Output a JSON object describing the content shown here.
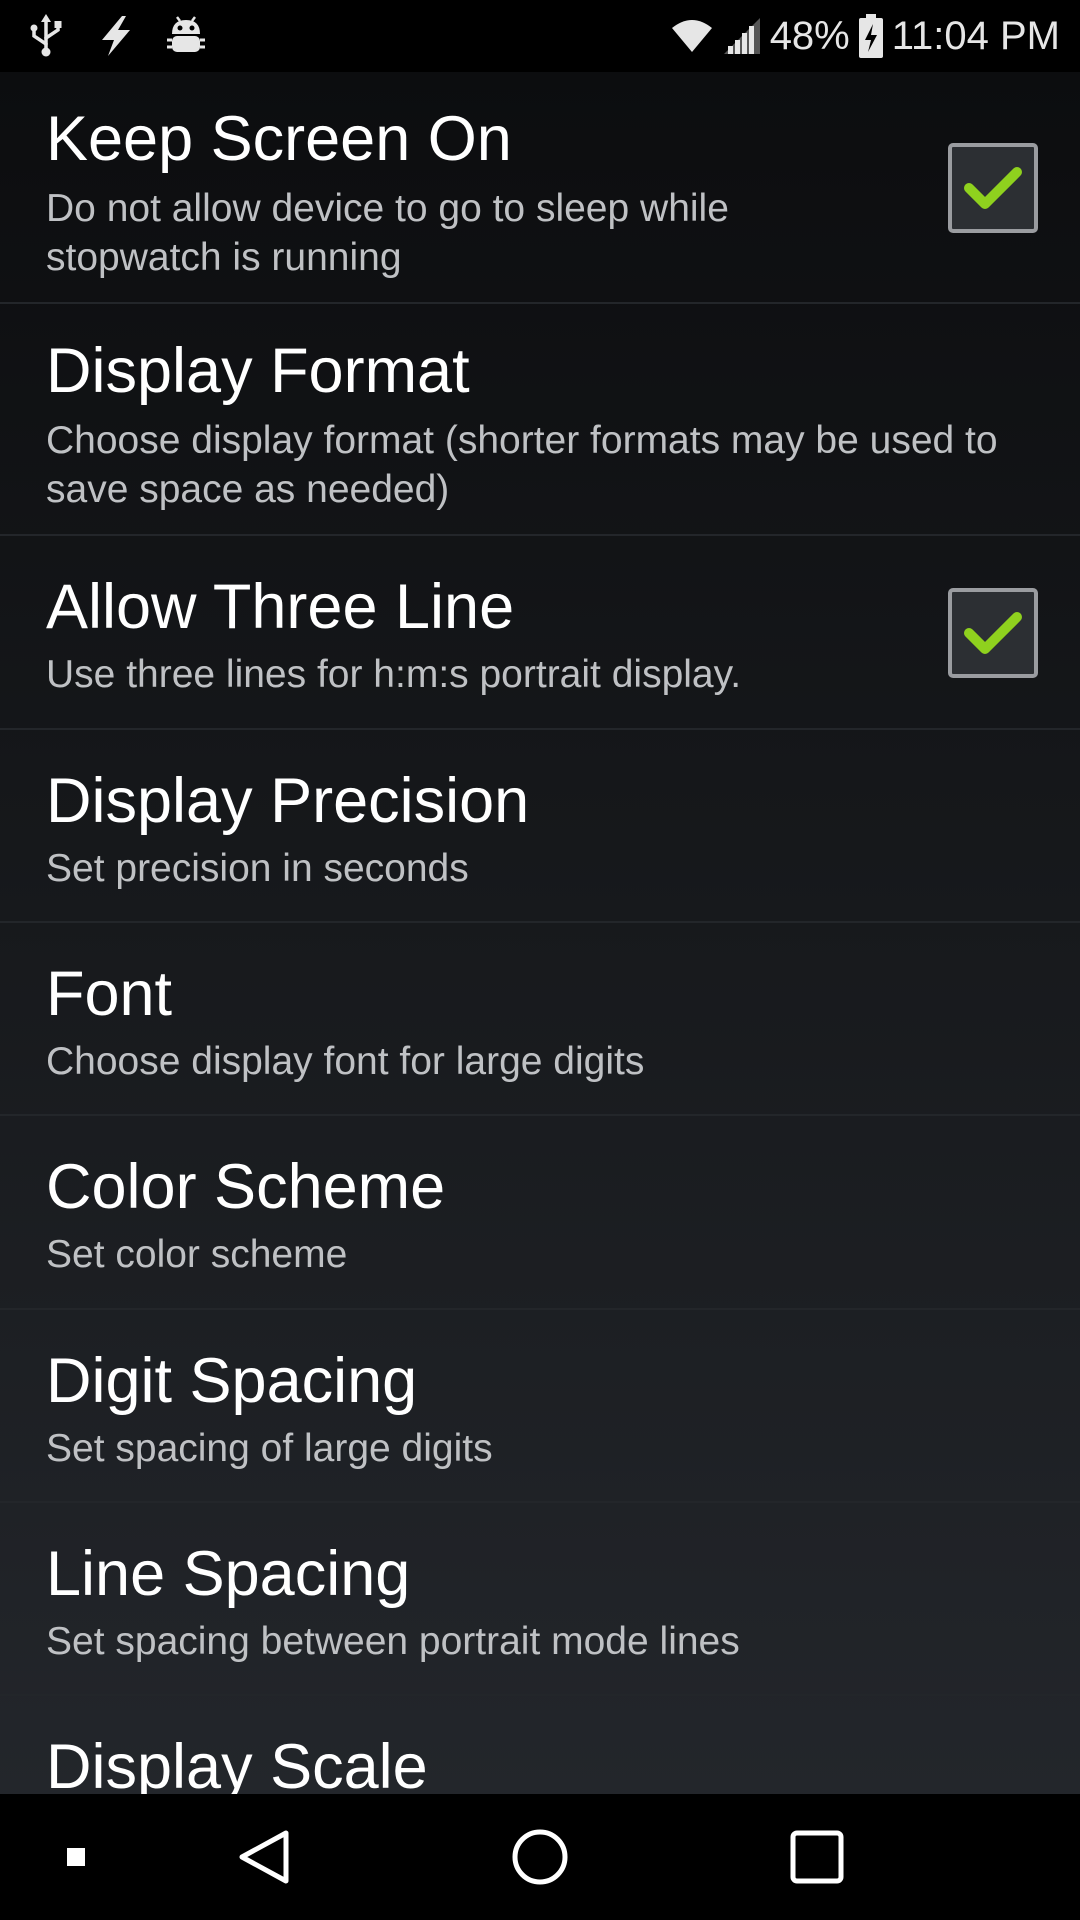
{
  "status_bar": {
    "left_icons": [
      "usb-icon",
      "flash-icon",
      "android-debug-icon"
    ],
    "right_icons": [
      "wifi-icon",
      "cell-signal-icon",
      "battery-charging-icon"
    ],
    "battery_percent": "48%",
    "time": "11:04 PM"
  },
  "preferences": [
    {
      "title": "Keep Screen On",
      "summary": "Do not allow device to go to sleep while stopwatch is running",
      "has_checkbox": true,
      "checked": true
    },
    {
      "title": "Display Format",
      "summary": "Choose display format (shorter formats may be used to save space as needed)",
      "has_checkbox": false
    },
    {
      "title": "Allow Three Line",
      "summary": "Use three lines for h:m:s portrait display.",
      "has_checkbox": true,
      "checked": true
    },
    {
      "title": "Display Precision",
      "summary": "Set precision in seconds",
      "has_checkbox": false
    },
    {
      "title": "Font",
      "summary": "Choose display font for large digits",
      "has_checkbox": false
    },
    {
      "title": "Color Scheme",
      "summary": "Set color scheme",
      "has_checkbox": false
    },
    {
      "title": "Digit Spacing",
      "summary": "Set spacing of large digits",
      "has_checkbox": false
    },
    {
      "title": "Line Spacing",
      "summary": "Set spacing between portrait mode lines",
      "has_checkbox": false
    },
    {
      "title": "Display Scale",
      "summary": "",
      "has_checkbox": false
    }
  ],
  "nav_bar": {
    "buttons": [
      "menu-dot-icon",
      "back-icon",
      "home-icon",
      "recents-icon"
    ]
  },
  "colors": {
    "checkmark": "#8fd11e",
    "title_text": "#ffffff",
    "summary_text": "#bfc1c4"
  }
}
